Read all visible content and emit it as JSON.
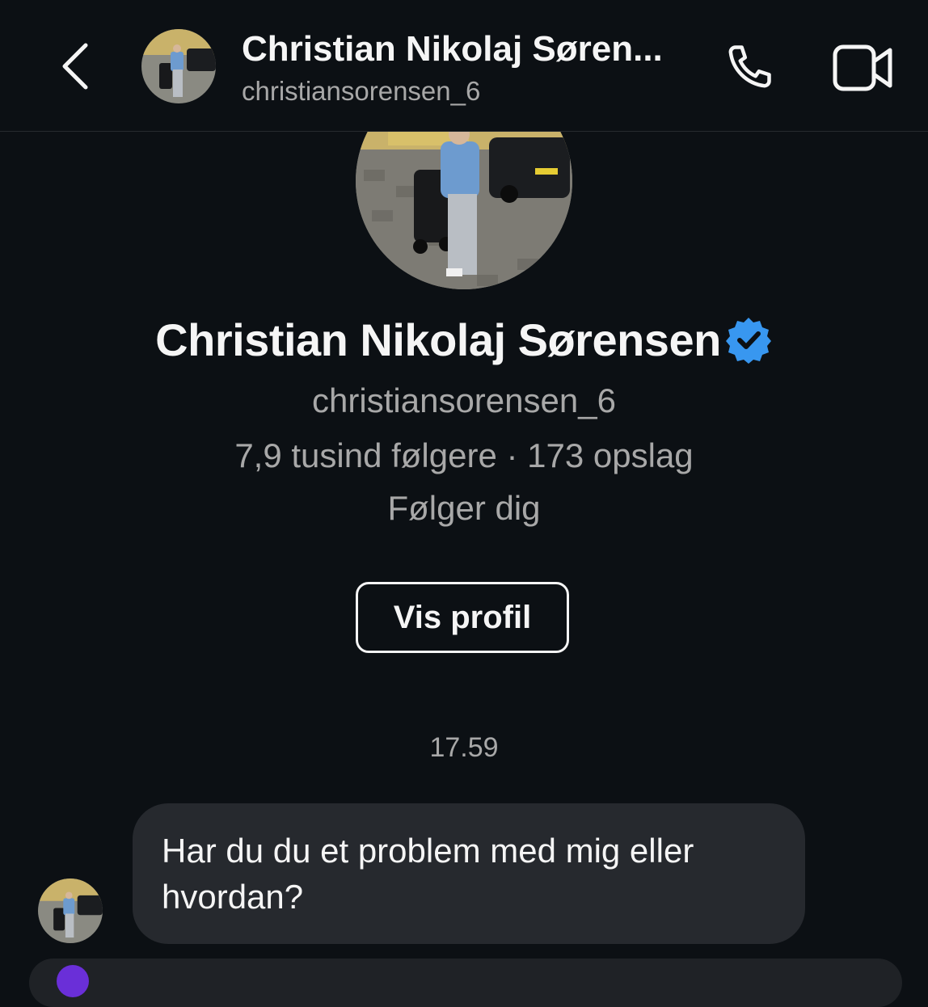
{
  "header": {
    "name": "Christian Nikolaj Søren...",
    "handle": "christiansorensen_6",
    "icons": {
      "back": "chevron-left-icon",
      "call": "phone-icon",
      "video": "video-camera-icon"
    }
  },
  "profile": {
    "name": "Christian Nikolaj Sørensen",
    "verified_icon": "verified-badge-icon",
    "handle": "christiansorensen_6",
    "stats": "7,9 tusind følgere · 173 opslag",
    "follows_you": "Følger dig",
    "view_profile_label": "Vis profil"
  },
  "chat": {
    "timestamp": "17.59",
    "messages": [
      {
        "text": "Har du du et problem med mig eller hvordan?"
      }
    ]
  },
  "colors": {
    "background": "#0c1014",
    "bubble": "#26292e",
    "secondary_text": "#a8a8a8",
    "verified": "#3897f0"
  }
}
